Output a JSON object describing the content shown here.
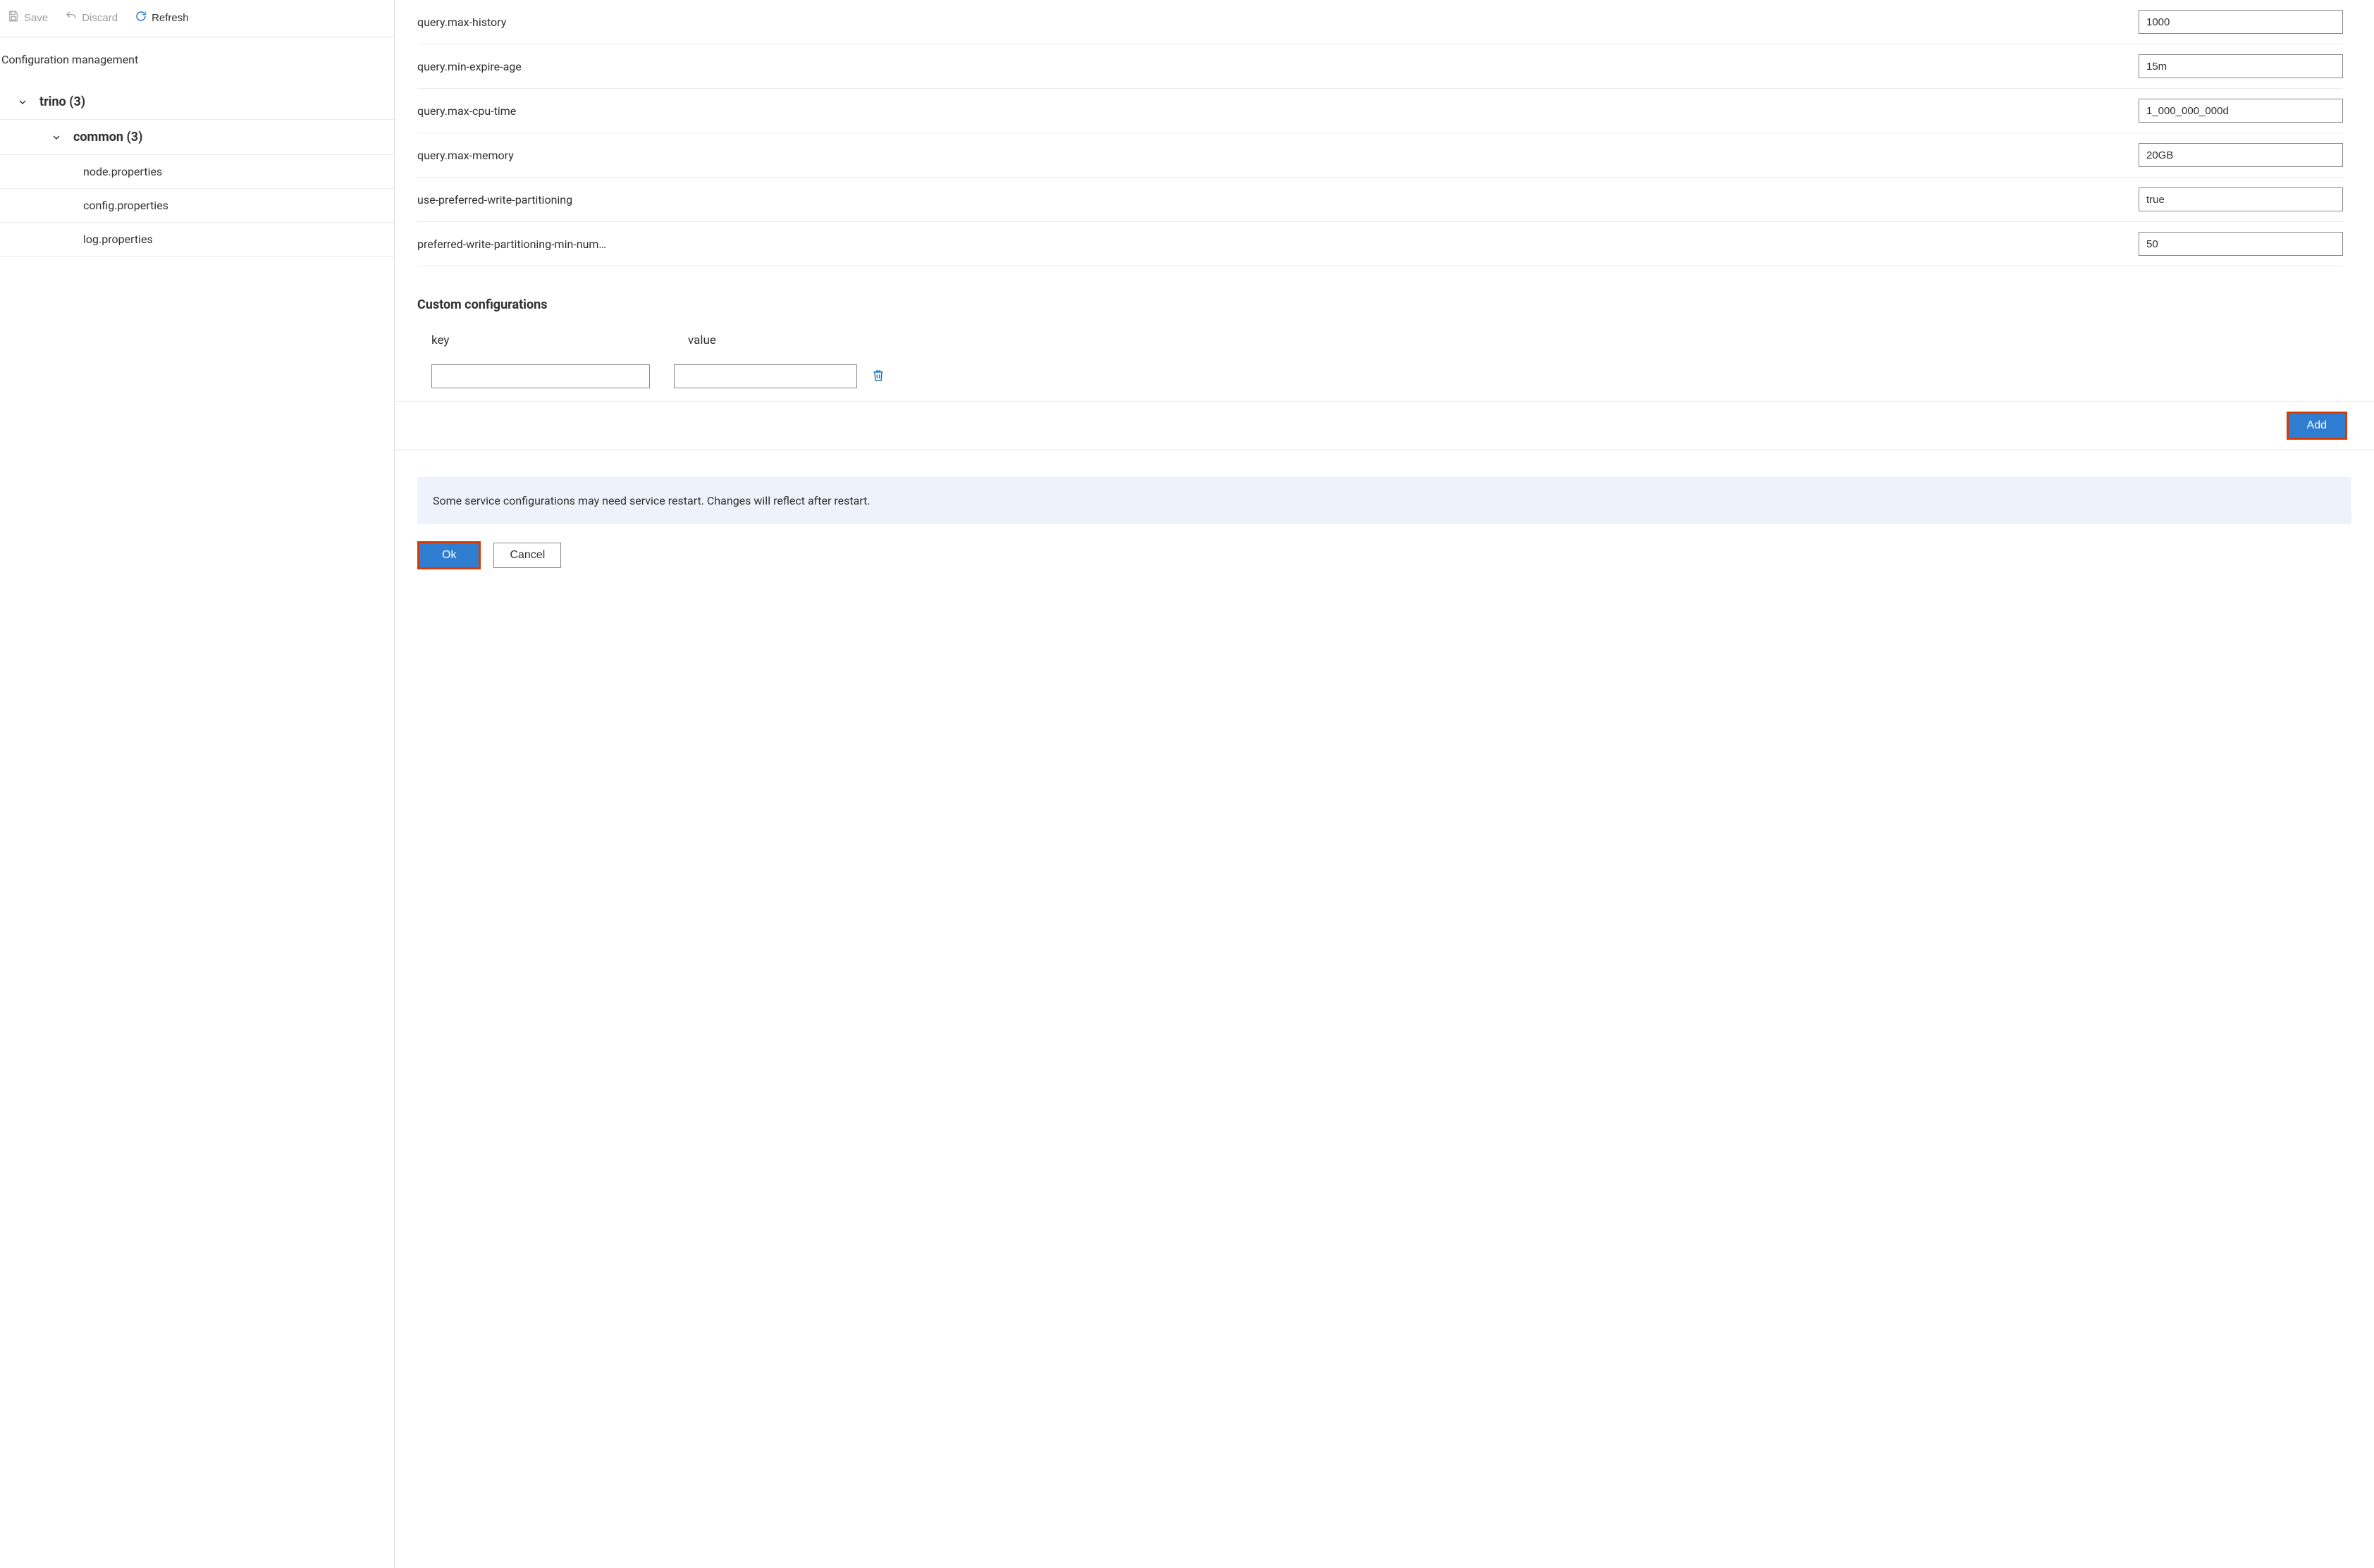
{
  "toolbar": {
    "save_label": "Save",
    "discard_label": "Discard",
    "refresh_label": "Refresh"
  },
  "breadcrumb": "Configuration management",
  "tree": {
    "trino_label": "trino (3)",
    "common_label": "common (3)",
    "files": {
      "node": "node.properties",
      "config": "config.properties",
      "log": "log.properties"
    }
  },
  "configs": [
    {
      "key": "query.max-history",
      "value": "1000"
    },
    {
      "key": "query.min-expire-age",
      "value": "15m"
    },
    {
      "key": "query.max-cpu-time",
      "value": "1_000_000_000d"
    },
    {
      "key": "query.max-memory",
      "value": "20GB"
    },
    {
      "key": "use-preferred-write-partitioning",
      "value": "true"
    },
    {
      "key": "preferred-write-partitioning-min-num…",
      "value": "50"
    }
  ],
  "custom_section_title": "Custom configurations",
  "custom_headers": {
    "key": "key",
    "value": "value"
  },
  "custom_rows": [
    {
      "key": "",
      "value": ""
    }
  ],
  "buttons": {
    "add": "Add",
    "ok": "Ok",
    "cancel": "Cancel"
  },
  "notice": "Some service configurations may need service restart. Changes will reflect after restart."
}
